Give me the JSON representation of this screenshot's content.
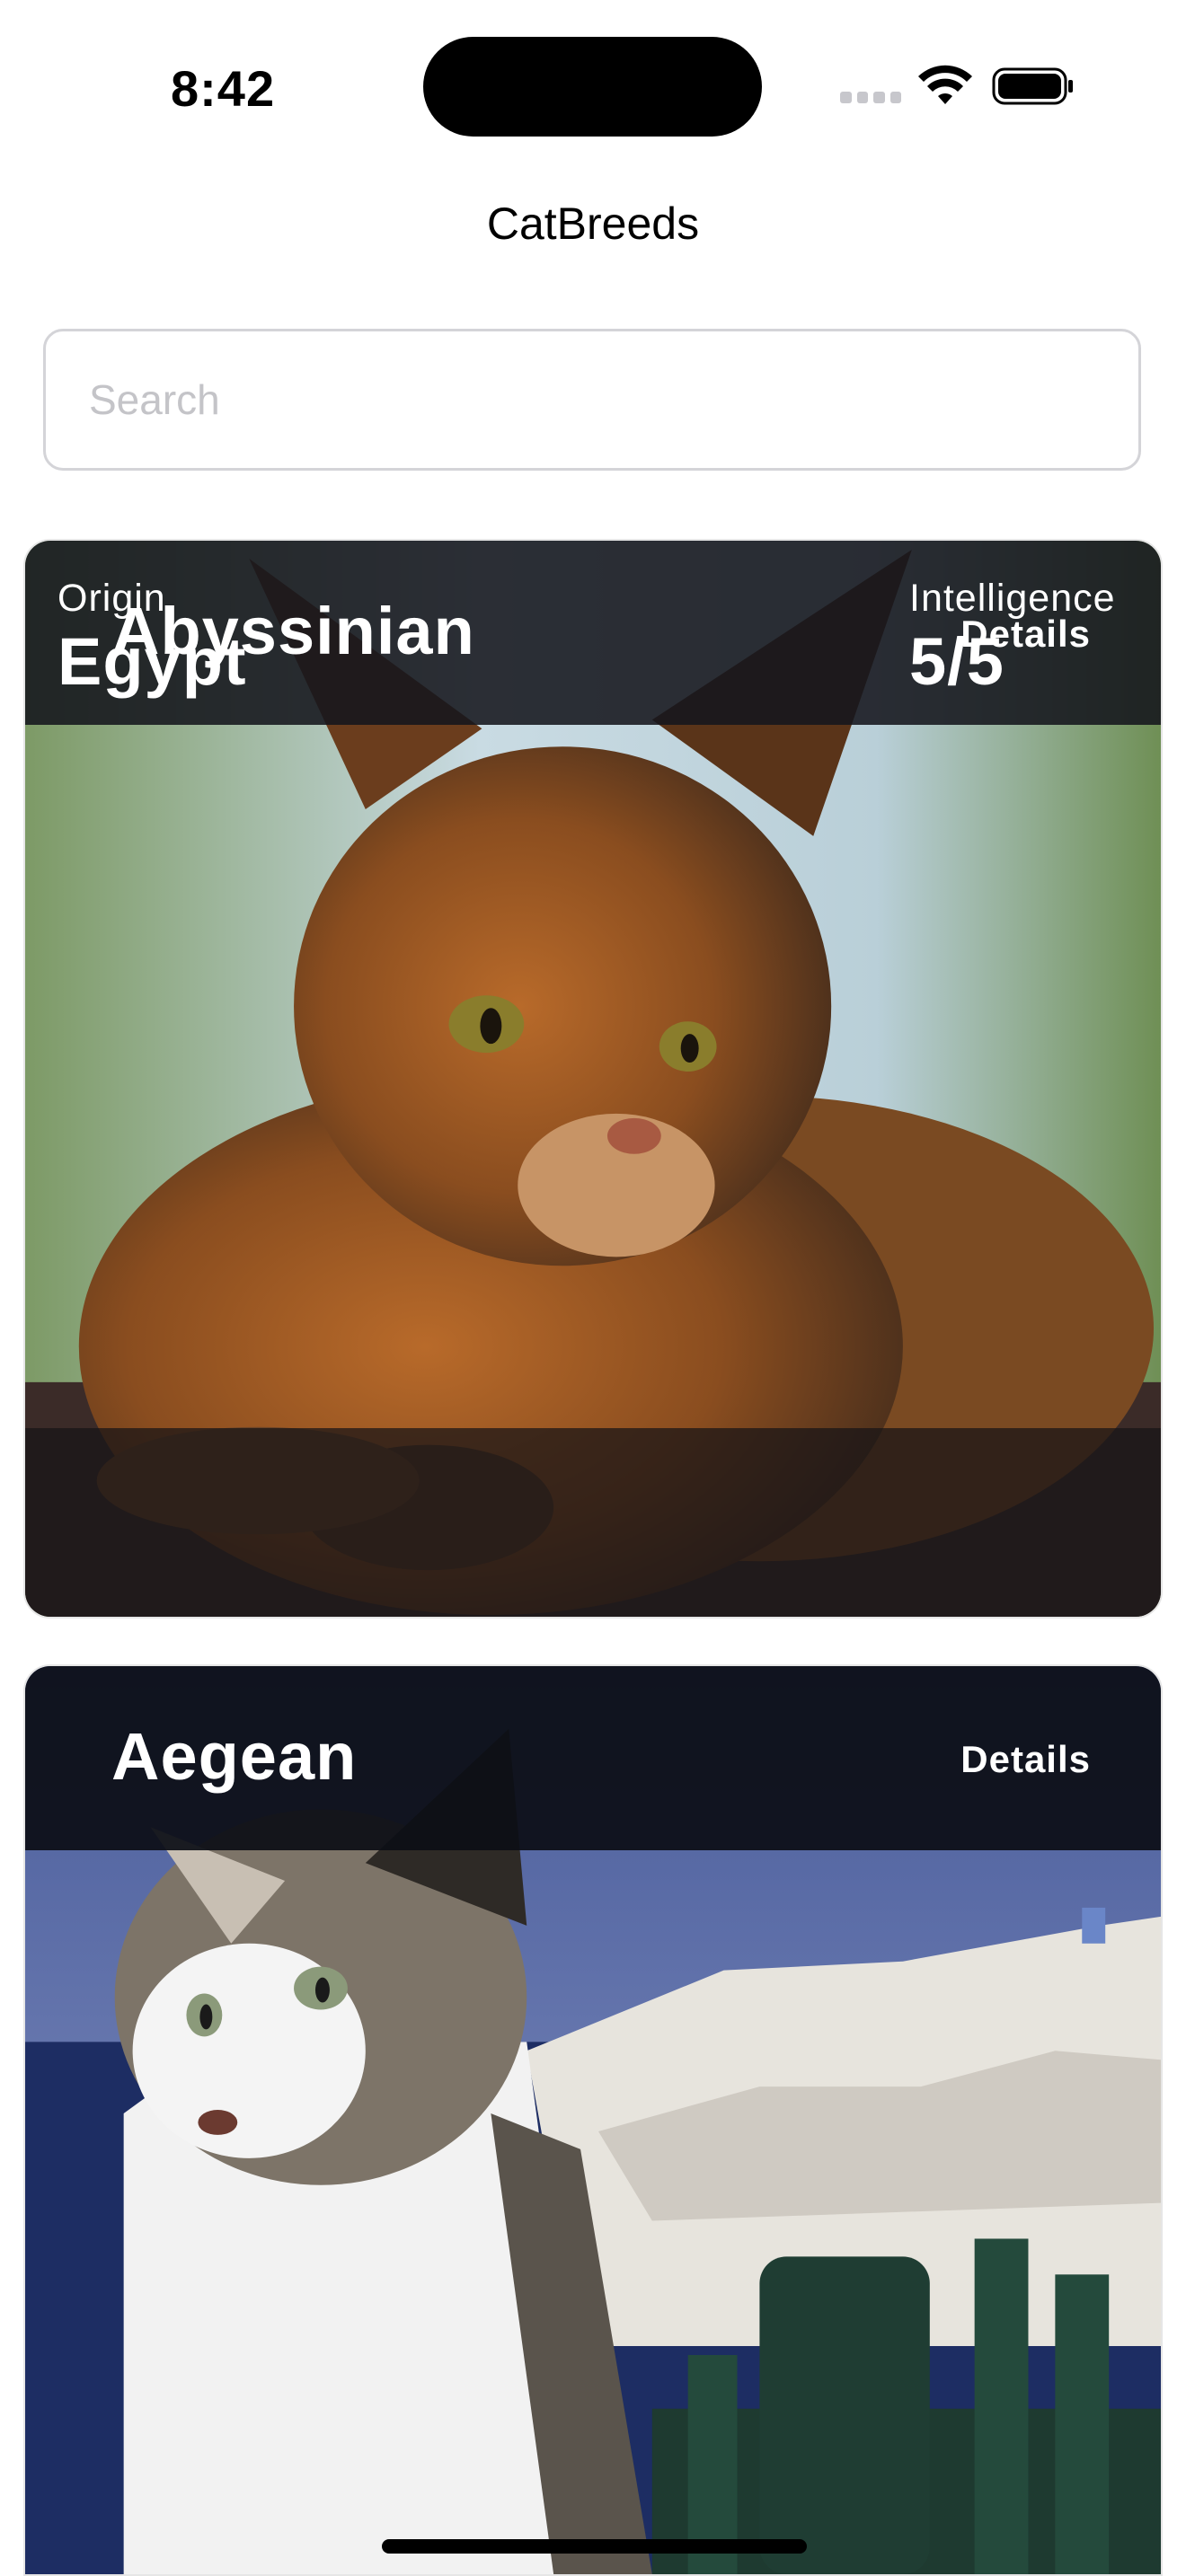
{
  "status_bar": {
    "time": "8:42"
  },
  "nav": {
    "title": "CatBreeds"
  },
  "search": {
    "placeholder": "Search",
    "value": ""
  },
  "breeds": [
    {
      "name": "Abyssinian",
      "details_label": "Details",
      "origin_label": "Origin",
      "origin": "Egypt",
      "intelligence_label": "Intelligence",
      "intelligence": "5/5"
    },
    {
      "name": "Aegean",
      "details_label": "Details"
    }
  ]
}
